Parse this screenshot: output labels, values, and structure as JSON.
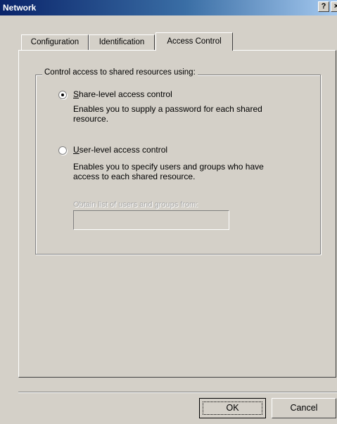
{
  "window": {
    "title": "Network",
    "help_label": "?",
    "close_label": "×"
  },
  "tabs": [
    {
      "label": "Configuration"
    },
    {
      "label": "Identification"
    },
    {
      "label": "Access Control"
    }
  ],
  "group": {
    "legend": "Control access to shared resources using:",
    "share_level": {
      "label": "Share-level access control",
      "accel": "S",
      "label_rest": "hare-level access control",
      "description_line1": "Enables you to supply a password for each shared",
      "description_line2": "resource.",
      "selected": true
    },
    "user_level": {
      "label": "User-level access control",
      "accel": "U",
      "label_rest": "ser-level access control",
      "description_line1": "Enables you to specify users and groups who have",
      "description_line2": "access to each shared resource.",
      "selected": false
    },
    "obtain_list_label": "Obtain list of users and groups from:",
    "obtain_list_value": ""
  },
  "buttons": {
    "ok": "OK",
    "cancel": "Cancel"
  }
}
